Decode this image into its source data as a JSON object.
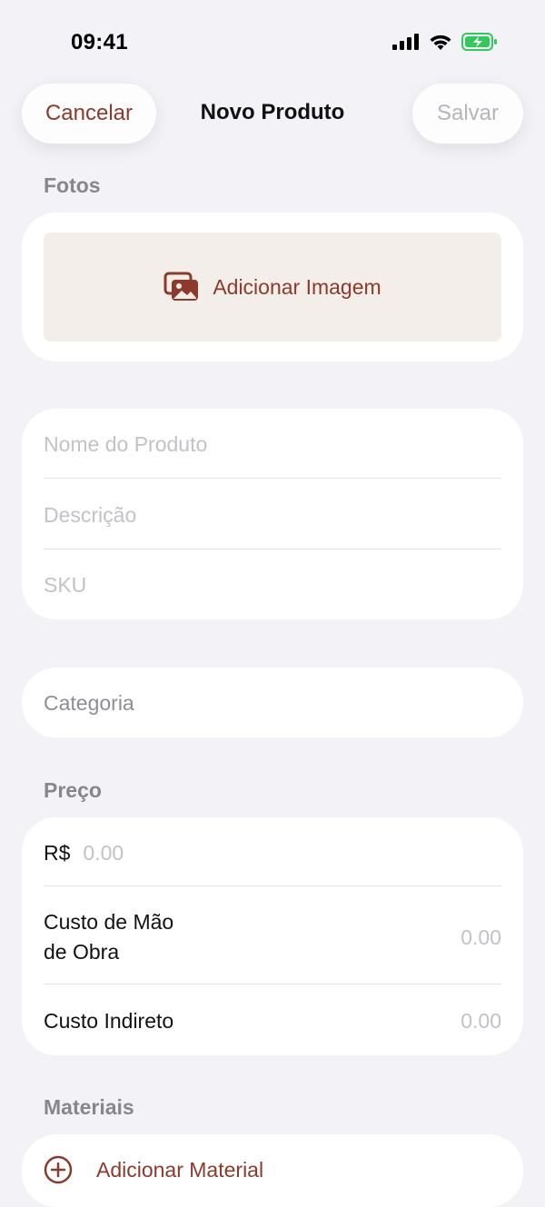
{
  "status_bar": {
    "time": "09:41",
    "icons": [
      "cellular-signal-icon",
      "wifi-icon",
      "battery-charging-icon"
    ],
    "battery_color": "#34C759"
  },
  "nav": {
    "cancel_label": "Cancelar",
    "title": "Novo Produto",
    "save_label": "Salvar"
  },
  "photos": {
    "header": "Fotos",
    "add_image_label": "Adicionar Imagem",
    "icon": "photo-stack-icon"
  },
  "details": {
    "name_placeholder": "Nome do Produto",
    "description_placeholder": "Descrição",
    "sku_placeholder": "SKU"
  },
  "category": {
    "placeholder": "Categoria"
  },
  "price": {
    "header": "Preço",
    "currency_label": "R$",
    "price_placeholder": "0.00",
    "labor_cost_label_line1": "Custo de Mão",
    "labor_cost_label_line2": "de Obra",
    "labor_cost_placeholder": "0.00",
    "indirect_cost_label": "Custo Indireto",
    "indirect_cost_placeholder": "0.00"
  },
  "materials": {
    "header": "Materiais",
    "add_label": "Adicionar Material",
    "icon": "plus-circle-icon"
  },
  "colors": {
    "accent": "#8B3A2B",
    "background": "#F2F2F7",
    "photo_area": "#F3EEEA"
  }
}
